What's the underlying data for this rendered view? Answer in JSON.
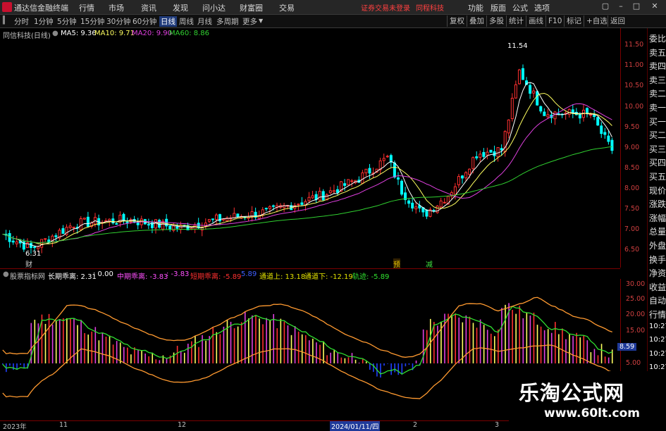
{
  "titlebar": {
    "app_title": "通达信金融终端",
    "menus": [
      "行情",
      "市场",
      "资讯",
      "发现",
      "问小达",
      "财富圈",
      "交易"
    ],
    "warning": "证券交易未登录",
    "stock_name": "同程科技",
    "right_menus": [
      "功能",
      "版面",
      "公式",
      "选项"
    ]
  },
  "toolbar": {
    "periods": [
      "分时",
      "1分钟",
      "5分钟",
      "15分钟",
      "30分钟",
      "60分钟",
      "日线",
      "周线",
      "月线",
      "多周期",
      "更多"
    ],
    "active_period": "日线",
    "right_tools": [
      "复权",
      "叠加",
      "多股",
      "统计",
      "画线",
      "F10",
      "标记",
      "+自选",
      "返回"
    ]
  },
  "ma_header": {
    "title": "同信科技(日线)",
    "ma5_label": "MA5: 9.36",
    "ma10_label": "MA10: 9.71",
    "ma20_label": "MA20: 9.90",
    "ma60_label": "MA60: 8.86"
  },
  "colors": {
    "up": "#ff3030",
    "down": "#00ffff",
    "ma5": "#ffffff",
    "ma10": "#ffff60",
    "ma20": "#e040e0",
    "ma60": "#30d030",
    "axis": "#d04040"
  },
  "price_axis": [
    "11.50",
    "11.00",
    "10.50",
    "10.00",
    "9.50",
    "9.00",
    "8.50",
    "8.00",
    "7.50",
    "7.00",
    "6.50"
  ],
  "annotations": {
    "high": "11.54",
    "low": "6.31",
    "marker_cai": "财",
    "marker_yu": "预",
    "marker_jian": "减"
  },
  "side_panel": [
    "委比",
    "卖五",
    "卖四",
    "卖三",
    "卖二",
    "卖一",
    "买一",
    "买二",
    "买三",
    "买四",
    "买五",
    "现价",
    "涨跌",
    "涨幅",
    "总量",
    "外盘",
    "换手",
    "净资",
    "收益",
    "自动",
    "行情",
    "10:27",
    "10:27",
    "10:27",
    "10:27",
    "10:27",
    "10:27",
    "10:27"
  ],
  "indicator_header": {
    "name": "股票指标网",
    "long_line": "长期乖离: 2.31",
    "zero": ": 0.00",
    "mid_line": "中期乖离: -3.83",
    "mid_line2": ": -3.83",
    "short_line": "短期乖离: -5.89",
    "dot": "5.89",
    "upper": "通道上: 13.18",
    "lower": "通道下: -12.19",
    "track": "轨迹: -5.89"
  },
  "indicator_axis": [
    "30.00",
    "25.00",
    "20.00",
    "15.00",
    "10.00",
    "5.00"
  ],
  "indicator_current": "8.59",
  "date_axis": [
    "2023年",
    "11",
    "12",
    "2024/01/11/四",
    "2",
    "3"
  ],
  "watermark": {
    "title": "乐淘公式网",
    "url": "www.60lt.com"
  }
}
